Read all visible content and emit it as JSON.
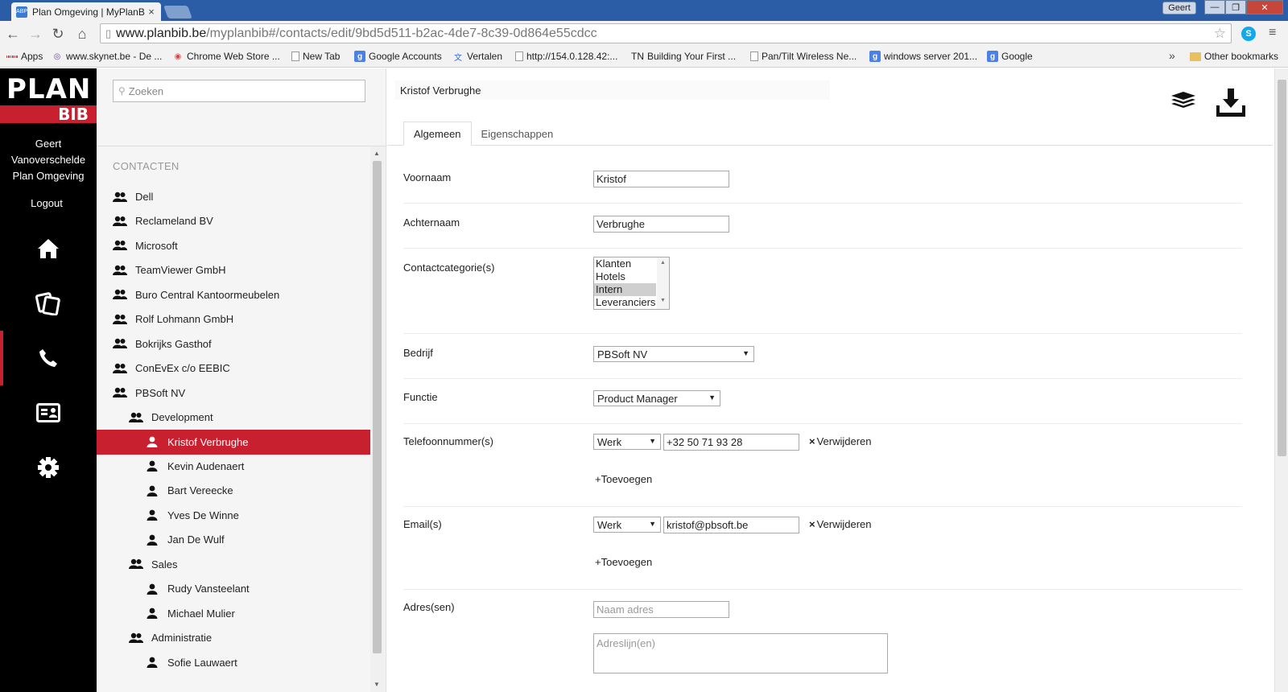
{
  "browser": {
    "tab_title": "Plan Omgeving | MyPlanB",
    "tab_favicon": "ABP",
    "user_badge": "Geert",
    "url_host": "www.planbib.be",
    "url_path": "/myplanbib#/contacts/edit/9bd5d511-b2ac-4de7-8c39-0d864e55cdcc",
    "bookmarks": [
      "Apps",
      "www.skynet.be - De ...",
      "Chrome Web Store ...",
      "New Tab",
      "Google Accounts",
      "Vertalen",
      "http://154.0.128.42:...",
      "Building Your First ...",
      "Pan/Tilt Wireless Ne...",
      "windows server 201...",
      "Google"
    ],
    "bookmark_tn_prefix": "TN",
    "other_bookmarks": "Other bookmarks",
    "more_chevron": "»"
  },
  "app": {
    "logo_plan": "PLAN",
    "logo_bib": "BIB",
    "user_line1": "Geert",
    "user_line2": "Vanoverschelde",
    "user_line3": "Plan Omgeving",
    "logout": "Logout",
    "nav_icons": [
      "home-icon",
      "documents-icon",
      "phone-icon",
      "contact-card-icon",
      "gear-icon"
    ],
    "active_nav": "phone-icon",
    "accent_color": "#c8202f"
  },
  "sidebar": {
    "search_placeholder": "Zoeken",
    "heading": "CONTACTEN",
    "items": [
      {
        "label": "Dell",
        "type": "group"
      },
      {
        "label": "Reclameland BV",
        "type": "group"
      },
      {
        "label": "Microsoft",
        "type": "group"
      },
      {
        "label": "TeamViewer GmbH",
        "type": "group"
      },
      {
        "label": "Buro Central Kantoormeubelen",
        "type": "group"
      },
      {
        "label": "Rolf Lohmann GmbH",
        "type": "group"
      },
      {
        "label": "Bokrijks Gasthof",
        "type": "group"
      },
      {
        "label": "ConEvEx c/o EEBIC",
        "type": "group"
      },
      {
        "label": "PBSoft NV",
        "type": "group"
      },
      {
        "label": "Development",
        "type": "group"
      },
      {
        "label": "Kristof Verbrughe",
        "type": "person",
        "selected": true
      },
      {
        "label": "Kevin Audenaert",
        "type": "person"
      },
      {
        "label": "Bart Vereecke",
        "type": "person"
      },
      {
        "label": "Yves De Winne",
        "type": "person"
      },
      {
        "label": "Jan De Wulf",
        "type": "person"
      },
      {
        "label": "Sales",
        "type": "group"
      },
      {
        "label": "Rudy Vansteelant",
        "type": "person"
      },
      {
        "label": "Michael Mulier",
        "type": "person"
      },
      {
        "label": "Administratie",
        "type": "group"
      },
      {
        "label": "Sofie Lauwaert",
        "type": "person"
      }
    ]
  },
  "main": {
    "title": "Kristof Verbrughe",
    "tabs": [
      "Algemeen",
      "Eigenschappen"
    ],
    "active_tab": "Algemeen",
    "form": {
      "voornaam_label": "Voornaam",
      "voornaam_value": "Kristof",
      "achternaam_label": "Achternaam",
      "achternaam_value": "Verbrughe",
      "categories_label": "Contactcategorie(s)",
      "categories": [
        "Klanten",
        "Hotels",
        "Intern",
        "Leveranciers"
      ],
      "categories_selected": "Intern",
      "bedrijf_label": "Bedrijf",
      "bedrijf_value": "PBSoft NV",
      "functie_label": "Functie",
      "functie_value": "Product Manager",
      "phone_label": "Telefoonnummer(s)",
      "phone_type": "Werk",
      "phone_value": "+32 50 71 93 28",
      "email_label": "Email(s)",
      "email_type": "Werk",
      "email_value": "kristof@pbsoft.be",
      "remove_label": "Verwijderen",
      "add_label": "Toevoegen",
      "address_label": "Adres(sen)",
      "address_name_placeholder": "Naam adres",
      "address_lines_placeholder": "Adreslijn(en)"
    }
  }
}
